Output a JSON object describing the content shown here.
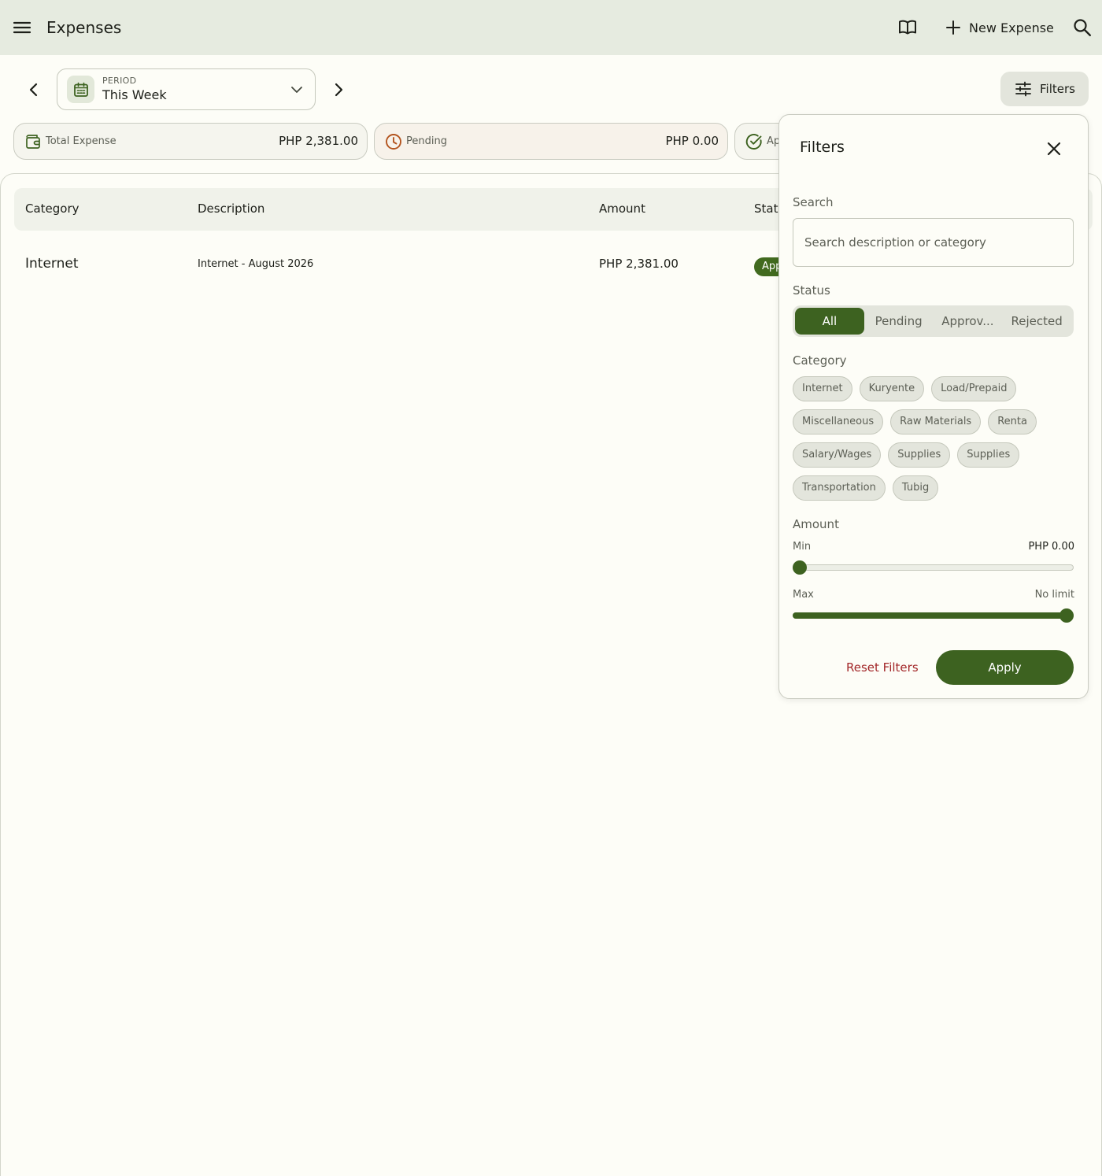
{
  "app_bar": {
    "title": "Expenses",
    "new_expense_label": "New Expense"
  },
  "period": {
    "label": "PERIOD",
    "value": "This Week"
  },
  "filters_button_label": "Filters",
  "summary": {
    "total_label": "Total Expense",
    "total_amount": "PHP 2,381.00",
    "pending_label": "Pending",
    "pending_amount": "PHP 0.00",
    "approved_label": "Ap"
  },
  "table": {
    "headers": [
      "Category",
      "Description",
      "Amount",
      "Statu"
    ],
    "rows": [
      {
        "category": "Internet",
        "description": "Internet - August 2026",
        "amount": "PHP 2,381.00",
        "status": "App"
      }
    ]
  },
  "filters_panel": {
    "title": "Filters",
    "search_label": "Search",
    "search_placeholder": "Search description or category",
    "status_label": "Status",
    "status_options": [
      "All",
      "Pending",
      "Approv...",
      "Rejected"
    ],
    "status_selected": "All",
    "category_label": "Category",
    "categories": [
      "Internet",
      "Kuryente",
      "Load/Prepaid",
      "Miscellaneous",
      "Raw Materials",
      "Renta",
      "Salary/Wages",
      "Supplies",
      "Supplies",
      "Transportation",
      "Tubig"
    ],
    "amount_label": "Amount",
    "min_label": "Min",
    "min_value": "PHP 0.00",
    "max_label": "Max",
    "max_value": "No limit",
    "min_slider_fraction": 0.0,
    "max_slider_fraction": 1.0,
    "reset_label": "Reset Filters",
    "apply_label": "Apply"
  },
  "colors": {
    "primary": "#3d6220",
    "app_bar_bg": "#e6ebe0",
    "reset_text": "#a3282a",
    "pending_icon": "#b3541e"
  }
}
